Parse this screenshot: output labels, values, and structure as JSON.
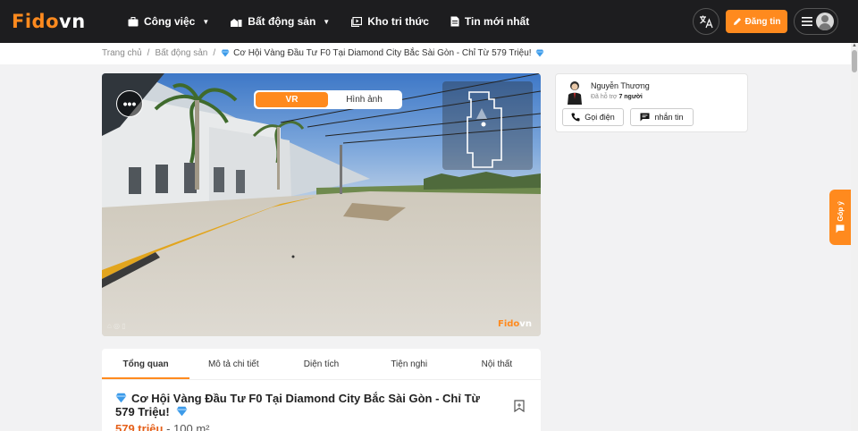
{
  "header": {
    "logo_main": "Fido",
    "logo_accent": "vn",
    "nav": [
      {
        "label": "Công việc",
        "icon": "briefcase-icon",
        "dropdown": true
      },
      {
        "label": "Bất động sản",
        "icon": "building-icon",
        "dropdown": true
      },
      {
        "label": "Kho tri thức",
        "icon": "library-icon",
        "dropdown": false
      },
      {
        "label": "Tin mới nhất",
        "icon": "news-icon",
        "dropdown": false
      }
    ],
    "post_label": "Đăng tin",
    "accent_color": "#ff8a1e"
  },
  "breadcrumb": {
    "home": "Trang chủ",
    "category": "Bất động sản",
    "current": "Cơ Hội Vàng Đầu Tư F0 Tại Diamond City Bắc Sài Gòn - Chỉ Từ 579 Triệu!"
  },
  "viewer": {
    "tabs": [
      "VR",
      "Hình ảnh"
    ],
    "active_tab": "VR",
    "watermark_main": "Fido",
    "watermark_accent": "vn"
  },
  "detail_tabs": [
    "Tổng quan",
    "Mô tả chi tiết",
    "Diện tích",
    "Tiện nghi",
    "Nội thất"
  ],
  "listing": {
    "title": "Cơ Hội Vàng Đầu Tư F0 Tại Diamond City Bắc Sài Gòn - Chỉ Từ 579 Triệu!",
    "price": "579 triệu",
    "area": " - 100 m²"
  },
  "agent": {
    "name": "Nguyễn Thương",
    "support_prefix": "Đã hỗ trợ ",
    "support_count": "7 người",
    "call_label": "Gọi điện",
    "message_label": "nhắn tin"
  },
  "feedback": {
    "label": "Góp ý"
  }
}
